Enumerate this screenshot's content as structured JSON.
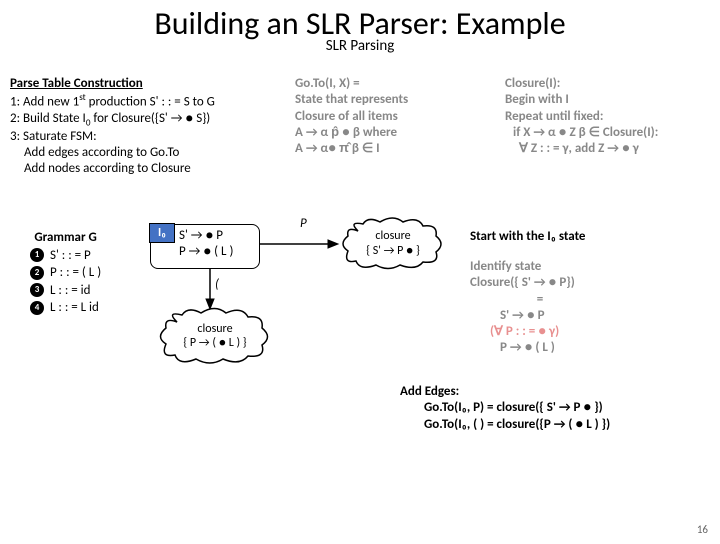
{
  "title": "Building an SLR Parser: Example",
  "subtitle": "SLR Parsing",
  "ptc": {
    "head": "Parse Table Construction",
    "l1a": "1: Add new 1",
    "l1sup": "st",
    "l1b": " production S' : : = S to G",
    "l2a": "2: Build State I",
    "l2sub": "0",
    "l2b": " for Closure({S' → ● S})",
    "l3": "3: Saturate FSM:",
    "l4": "Add edges according to Go.To",
    "l5": "Add nodes according to Closure"
  },
  "goto": {
    "l1": "Go.To(I, X) =",
    "l2": "State that represents",
    "l3": "Closure of all items",
    "l4": "A → α p̂ ● β  where",
    "l5": "A → α● π̂ β ∈ I"
  },
  "closure": {
    "l1": "Closure(I):",
    "l2": "Begin with I",
    "l3": "Repeat until fixed:",
    "l4": "if X → α ● Z β ∈ Closure(I):",
    "l5": "∀ Z : : = γ, add  Z → ● γ"
  },
  "grammar": {
    "head": "Grammar G",
    "r1": "S'  : : = P",
    "r2": "P  : : = ( L )",
    "r3": "L  : : = id",
    "r4": "L  : : = L id"
  },
  "i0": {
    "label": "I₀",
    "line1": "S' → ● P",
    "line2": "P → ● ( L )"
  },
  "cloudRight": {
    "l1": "closure",
    "l2": "{ S' → P ● }"
  },
  "cloudBottom": {
    "l1": "closure",
    "l2": "{ P → ( ● L ) }"
  },
  "start": "Start with the I₀ state",
  "identify": {
    "l1": "Identify state",
    "l2": "Closure({ S' → ● P})",
    "l3": "=",
    "l4": "S' → ● P",
    "l5": "(∀ P : : = ● γ)",
    "l6": "P → ● ( L )"
  },
  "edges": {
    "head": "Add Edges:",
    "l1": "Go.To(I₀, P) = closure({ S' → P ● })",
    "l2": "Go.To(I₀, ( ) = closure({P → ( ● L ) })"
  },
  "edgeLabels": {
    "p": "P",
    "paren": "("
  },
  "pagenum": "16"
}
